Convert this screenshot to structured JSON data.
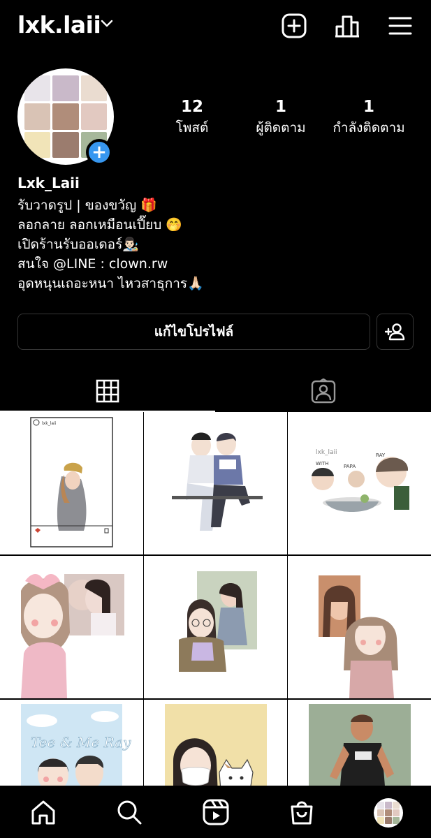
{
  "header": {
    "username": "lxk.laii",
    "icons": [
      "chevron-down-icon",
      "new-post-icon",
      "insights-icon",
      "menu-icon"
    ]
  },
  "profile": {
    "stats": [
      {
        "value": "12",
        "label": "โพสต์"
      },
      {
        "value": "1",
        "label": "ผู้ติดตาม"
      },
      {
        "value": "1",
        "label": "กำลังติดตาม"
      }
    ],
    "display_name": "Lxk_Laii",
    "bio": [
      "รับวาดรูป | ของขวัญ 🎁",
      "ลอกลาย ลอกเหมือนเปี๊ยบ 🤭",
      "เปิดร้านรับออเดอร์👨🏻‍🎨",
      "สนใจ @LINE : clown.rw",
      "อุดหนุนเถอะหนา ไหวสาธุการ🙏🏻"
    ],
    "edit_button": "แก้ไขโปรไฟล์",
    "add_badge": "+"
  },
  "tabs": [
    {
      "name": "posts-grid-icon",
      "active": true
    },
    {
      "name": "tagged-icon",
      "active": false
    }
  ],
  "posts": [
    {
      "name": "post-1",
      "bg": "#ffffff"
    },
    {
      "name": "post-2",
      "bg": "#ffffff"
    },
    {
      "name": "post-3",
      "bg": "#ffffff"
    },
    {
      "name": "post-4",
      "bg": "#ffffff"
    },
    {
      "name": "post-5",
      "bg": "#ffffff"
    },
    {
      "name": "post-6",
      "bg": "#ffffff"
    },
    {
      "name": "post-7",
      "bg": "#ffffff"
    },
    {
      "name": "post-8",
      "bg": "#ffffff"
    },
    {
      "name": "post-9",
      "bg": "#ffffff"
    }
  ],
  "post_texts": {
    "post1_caption": "ลxk_laii",
    "post3_with": "WITH",
    "post3_papa": "PAPA",
    "post3_ray": "RAY",
    "post7_title": "Tee & Me Ray"
  },
  "bottom_nav": [
    "home-icon",
    "search-icon",
    "reels-icon",
    "shop-icon",
    "profile-avatar"
  ],
  "colors": {
    "accent": "#3797f0",
    "background": "#000000",
    "border": "#363636"
  }
}
